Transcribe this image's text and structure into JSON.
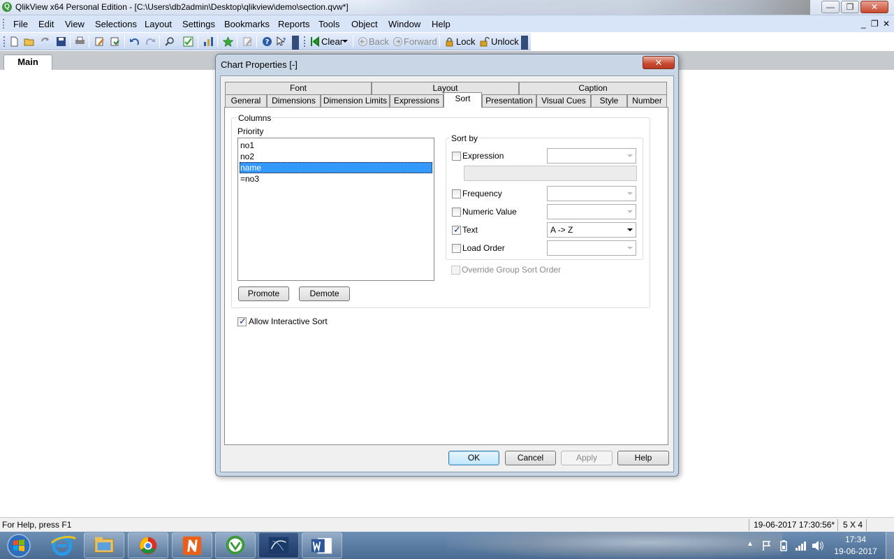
{
  "window": {
    "title": "QlikView x64 Personal Edition - [C:\\Users\\db2admin\\Desktop\\qlikview\\demo\\section.qvw*]",
    "logo_letter": "Q",
    "controls": [
      "—",
      "❐",
      "✕"
    ]
  },
  "menu": [
    "File",
    "Edit",
    "View",
    "Selections",
    "Layout",
    "Settings",
    "Bookmarks",
    "Reports",
    "Tools",
    "Object",
    "Window",
    "Help"
  ],
  "mdi_controls": [
    "_",
    "❐",
    "✕"
  ],
  "toolbar": {
    "clear_label": "Clear",
    "back_label": "Back",
    "forward_label": "Forward",
    "lock_label": "Lock",
    "unlock_label": "Unlock"
  },
  "sheet_tabs": [
    "Main"
  ],
  "dialog": {
    "title": "Chart Properties [-]",
    "close_glyph": "✕",
    "tabs_row1": [
      "Font",
      "Layout",
      "Caption"
    ],
    "tabs_row2": [
      "General",
      "Dimensions",
      "Dimension Limits",
      "Expressions",
      "Sort",
      "Presentation",
      "Visual Cues",
      "Style",
      "Number"
    ],
    "active_tab": "Sort",
    "columns_label": "Columns",
    "priority_label": "Priority",
    "priority_items": [
      "no1",
      "no2",
      "name",
      "=no3"
    ],
    "selected_item": "name",
    "promote_label": "Promote",
    "demote_label": "Demote",
    "sort_by_label": "Sort by",
    "sort_options": [
      {
        "label": "Expression",
        "checked": false,
        "value": ""
      },
      {
        "label": "Frequency",
        "checked": false,
        "value": ""
      },
      {
        "label": "Numeric Value",
        "checked": false,
        "value": ""
      },
      {
        "label": "Text",
        "checked": true,
        "value": "A -> Z"
      },
      {
        "label": "Load Order",
        "checked": false,
        "value": ""
      }
    ],
    "override_label": "Override Group Sort Order",
    "allow_interactive_sort_label": "Allow Interactive Sort",
    "allow_interactive_sort_checked": true,
    "buttons": {
      "ok": "OK",
      "cancel": "Cancel",
      "apply": "Apply",
      "help": "Help"
    }
  },
  "statusbar": {
    "help_text": "For Help, press F1",
    "timestamp": "19-06-2017 17:30:56*",
    "grid": "5 X 4"
  },
  "taskbar": {
    "time": "17:34",
    "date": "19-06-2017",
    "tray_arrow": "▲"
  }
}
